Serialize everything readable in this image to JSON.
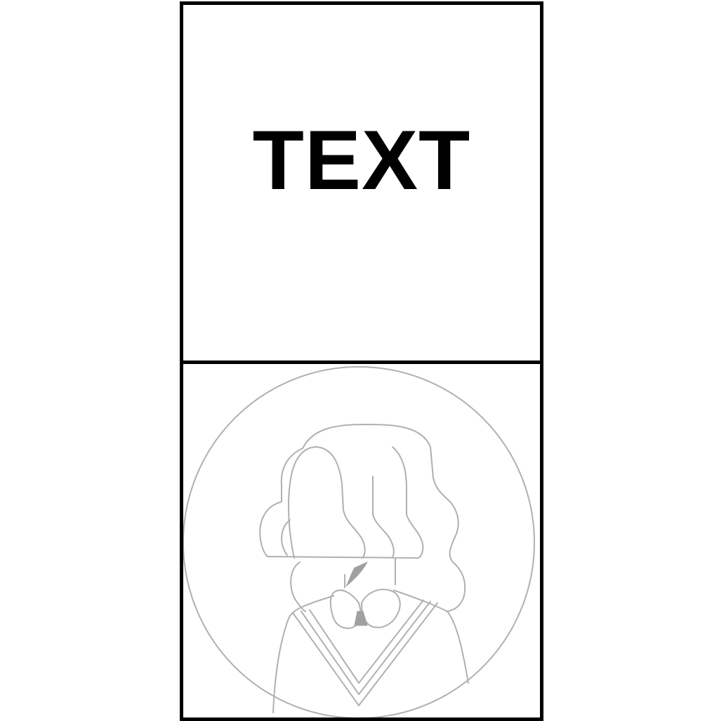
{
  "card": {
    "text_panel": {
      "label": "TEXT"
    },
    "image_panel": {
      "icon": "avatar-placeholder-icon",
      "stroke_color": "#b0b0b0",
      "accent_color": "#a0a0a0"
    },
    "border_color": "#000000"
  }
}
